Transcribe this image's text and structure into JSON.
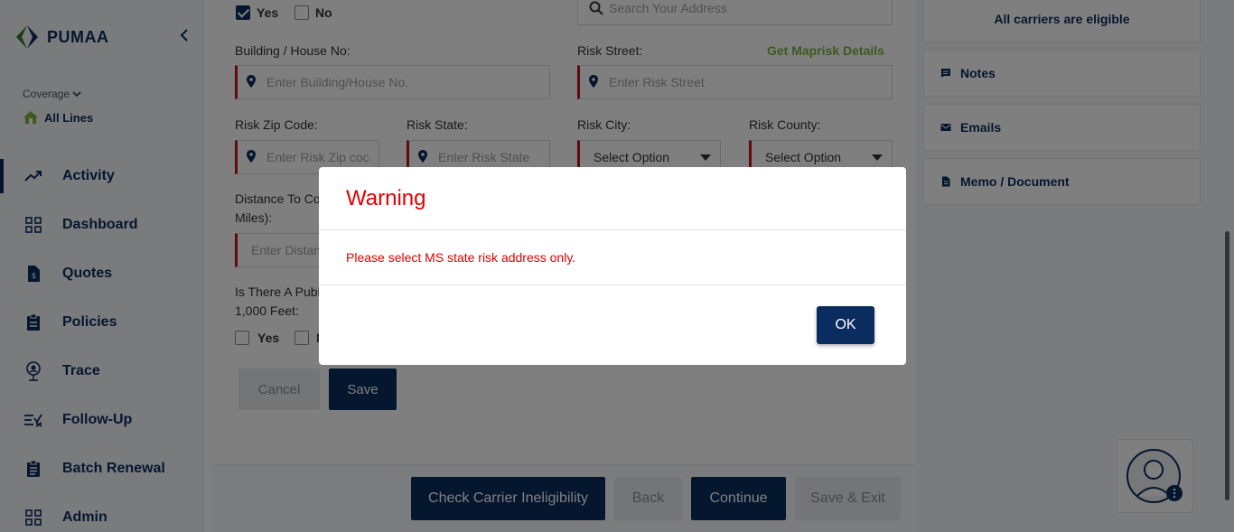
{
  "app": {
    "name": "PUMAA"
  },
  "sidebar": {
    "coverage_label": "Coverage",
    "coverage_value": "All Lines",
    "items": [
      {
        "label": "Activity",
        "icon": "trending-up-icon"
      },
      {
        "label": "Dashboard",
        "icon": "grid-icon"
      },
      {
        "label": "Quotes",
        "icon": "quote-doc-icon"
      },
      {
        "label": "Policies",
        "icon": "clipboard-icon"
      },
      {
        "label": "Trace",
        "icon": "trace-pin-icon"
      },
      {
        "label": "Follow-Up",
        "icon": "follow-up-icon"
      },
      {
        "label": "Batch Renewal",
        "icon": "clipboard-list-icon"
      },
      {
        "label": "Admin",
        "icon": "grid-icon"
      }
    ]
  },
  "form": {
    "yes_label": "Yes",
    "no_label": "No",
    "search_placeholder": "Search Your Address",
    "building_label": "Building / House No:",
    "building_placeholder": "Enter Building/House No.",
    "risk_street_label": "Risk Street:",
    "risk_street_placeholder": "Enter Risk Street",
    "maprisk_link": "Get Maprisk Details",
    "zip_label": "Risk Zip Code:",
    "zip_placeholder": "Enter Risk Zip coc",
    "state_label": "Risk State:",
    "state_placeholder": "Enter Risk State",
    "city_label": "Risk City:",
    "city_value": "Select Option",
    "county_label": "Risk County:",
    "county_value": "Select Option",
    "distance_label_1": "Distance To Co",
    "distance_label_2": "Miles):",
    "distance_placeholder": "Enter Distan",
    "public_label_1": "Is There A Publ",
    "public_label_2": "1,000 Feet:",
    "public_yes": "Yes",
    "public_no": "N",
    "cancel": "Cancel",
    "save": "Save"
  },
  "footer": {
    "check_carrier": "Check Carrier Ineligibility",
    "back": "Back",
    "continue": "Continue",
    "save_exit": "Save & Exit"
  },
  "right_panel": {
    "eligible": "All carriers are eligible",
    "notes": "Notes",
    "emails": "Emails",
    "memo": "Memo / Document"
  },
  "modal": {
    "title": "Warning",
    "message": "Please select MS state risk address only.",
    "ok": "OK"
  },
  "colors": {
    "primary": "#0b2c5f",
    "warning": "#e00000",
    "link_green": "#7cb342",
    "required_red": "#c1121f"
  }
}
